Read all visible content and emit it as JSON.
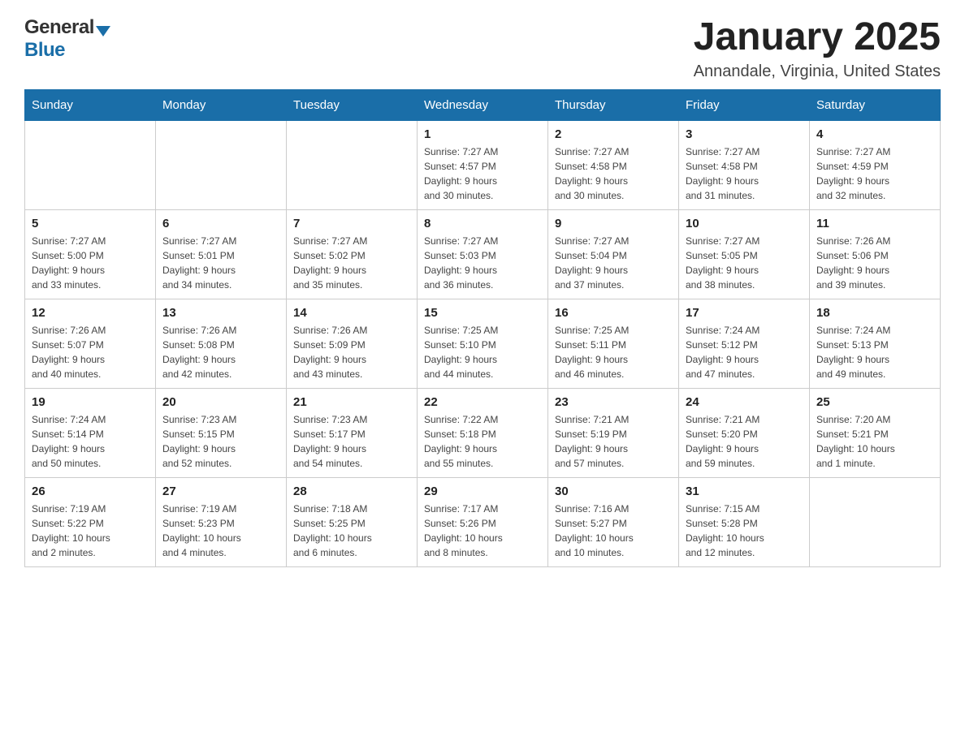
{
  "header": {
    "logo_general": "General",
    "logo_blue": "Blue",
    "month_title": "January 2025",
    "location": "Annandale, Virginia, United States"
  },
  "days_of_week": [
    "Sunday",
    "Monday",
    "Tuesday",
    "Wednesday",
    "Thursday",
    "Friday",
    "Saturday"
  ],
  "weeks": [
    [
      {
        "day": "",
        "info": ""
      },
      {
        "day": "",
        "info": ""
      },
      {
        "day": "",
        "info": ""
      },
      {
        "day": "1",
        "info": "Sunrise: 7:27 AM\nSunset: 4:57 PM\nDaylight: 9 hours\nand 30 minutes."
      },
      {
        "day": "2",
        "info": "Sunrise: 7:27 AM\nSunset: 4:58 PM\nDaylight: 9 hours\nand 30 minutes."
      },
      {
        "day": "3",
        "info": "Sunrise: 7:27 AM\nSunset: 4:58 PM\nDaylight: 9 hours\nand 31 minutes."
      },
      {
        "day": "4",
        "info": "Sunrise: 7:27 AM\nSunset: 4:59 PM\nDaylight: 9 hours\nand 32 minutes."
      }
    ],
    [
      {
        "day": "5",
        "info": "Sunrise: 7:27 AM\nSunset: 5:00 PM\nDaylight: 9 hours\nand 33 minutes."
      },
      {
        "day": "6",
        "info": "Sunrise: 7:27 AM\nSunset: 5:01 PM\nDaylight: 9 hours\nand 34 minutes."
      },
      {
        "day": "7",
        "info": "Sunrise: 7:27 AM\nSunset: 5:02 PM\nDaylight: 9 hours\nand 35 minutes."
      },
      {
        "day": "8",
        "info": "Sunrise: 7:27 AM\nSunset: 5:03 PM\nDaylight: 9 hours\nand 36 minutes."
      },
      {
        "day": "9",
        "info": "Sunrise: 7:27 AM\nSunset: 5:04 PM\nDaylight: 9 hours\nand 37 minutes."
      },
      {
        "day": "10",
        "info": "Sunrise: 7:27 AM\nSunset: 5:05 PM\nDaylight: 9 hours\nand 38 minutes."
      },
      {
        "day": "11",
        "info": "Sunrise: 7:26 AM\nSunset: 5:06 PM\nDaylight: 9 hours\nand 39 minutes."
      }
    ],
    [
      {
        "day": "12",
        "info": "Sunrise: 7:26 AM\nSunset: 5:07 PM\nDaylight: 9 hours\nand 40 minutes."
      },
      {
        "day": "13",
        "info": "Sunrise: 7:26 AM\nSunset: 5:08 PM\nDaylight: 9 hours\nand 42 minutes."
      },
      {
        "day": "14",
        "info": "Sunrise: 7:26 AM\nSunset: 5:09 PM\nDaylight: 9 hours\nand 43 minutes."
      },
      {
        "day": "15",
        "info": "Sunrise: 7:25 AM\nSunset: 5:10 PM\nDaylight: 9 hours\nand 44 minutes."
      },
      {
        "day": "16",
        "info": "Sunrise: 7:25 AM\nSunset: 5:11 PM\nDaylight: 9 hours\nand 46 minutes."
      },
      {
        "day": "17",
        "info": "Sunrise: 7:24 AM\nSunset: 5:12 PM\nDaylight: 9 hours\nand 47 minutes."
      },
      {
        "day": "18",
        "info": "Sunrise: 7:24 AM\nSunset: 5:13 PM\nDaylight: 9 hours\nand 49 minutes."
      }
    ],
    [
      {
        "day": "19",
        "info": "Sunrise: 7:24 AM\nSunset: 5:14 PM\nDaylight: 9 hours\nand 50 minutes."
      },
      {
        "day": "20",
        "info": "Sunrise: 7:23 AM\nSunset: 5:15 PM\nDaylight: 9 hours\nand 52 minutes."
      },
      {
        "day": "21",
        "info": "Sunrise: 7:23 AM\nSunset: 5:17 PM\nDaylight: 9 hours\nand 54 minutes."
      },
      {
        "day": "22",
        "info": "Sunrise: 7:22 AM\nSunset: 5:18 PM\nDaylight: 9 hours\nand 55 minutes."
      },
      {
        "day": "23",
        "info": "Sunrise: 7:21 AM\nSunset: 5:19 PM\nDaylight: 9 hours\nand 57 minutes."
      },
      {
        "day": "24",
        "info": "Sunrise: 7:21 AM\nSunset: 5:20 PM\nDaylight: 9 hours\nand 59 minutes."
      },
      {
        "day": "25",
        "info": "Sunrise: 7:20 AM\nSunset: 5:21 PM\nDaylight: 10 hours\nand 1 minute."
      }
    ],
    [
      {
        "day": "26",
        "info": "Sunrise: 7:19 AM\nSunset: 5:22 PM\nDaylight: 10 hours\nand 2 minutes."
      },
      {
        "day": "27",
        "info": "Sunrise: 7:19 AM\nSunset: 5:23 PM\nDaylight: 10 hours\nand 4 minutes."
      },
      {
        "day": "28",
        "info": "Sunrise: 7:18 AM\nSunset: 5:25 PM\nDaylight: 10 hours\nand 6 minutes."
      },
      {
        "day": "29",
        "info": "Sunrise: 7:17 AM\nSunset: 5:26 PM\nDaylight: 10 hours\nand 8 minutes."
      },
      {
        "day": "30",
        "info": "Sunrise: 7:16 AM\nSunset: 5:27 PM\nDaylight: 10 hours\nand 10 minutes."
      },
      {
        "day": "31",
        "info": "Sunrise: 7:15 AM\nSunset: 5:28 PM\nDaylight: 10 hours\nand 12 minutes."
      },
      {
        "day": "",
        "info": ""
      }
    ]
  ]
}
